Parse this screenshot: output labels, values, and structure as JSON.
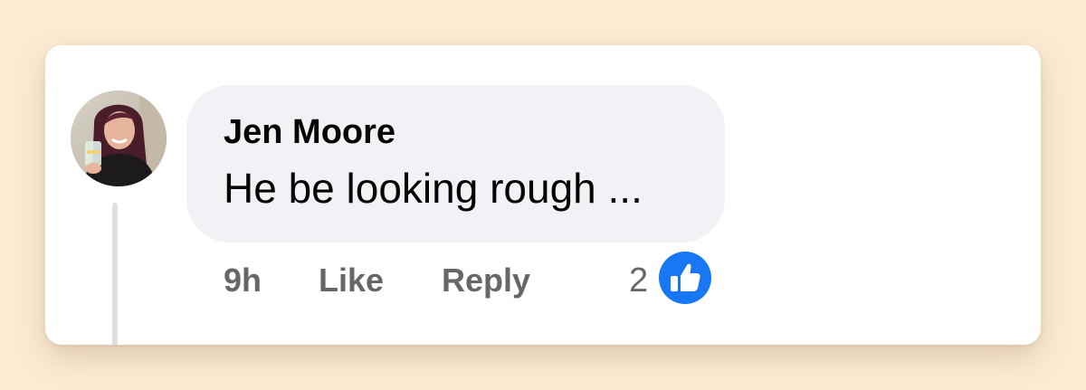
{
  "comment": {
    "author": "Jen Moore",
    "text": "He be looking rough ...",
    "time": "9h",
    "like_label": "Like",
    "reply_label": "Reply",
    "reaction_count": "2",
    "reaction_type": "like-icon"
  },
  "colors": {
    "page_background": "#fcebd3",
    "card_background": "#ffffff",
    "bubble_background": "#f0f2f5",
    "primary_text": "#050505",
    "secondary_text": "#65676b",
    "like_blue": "#1877f2"
  }
}
